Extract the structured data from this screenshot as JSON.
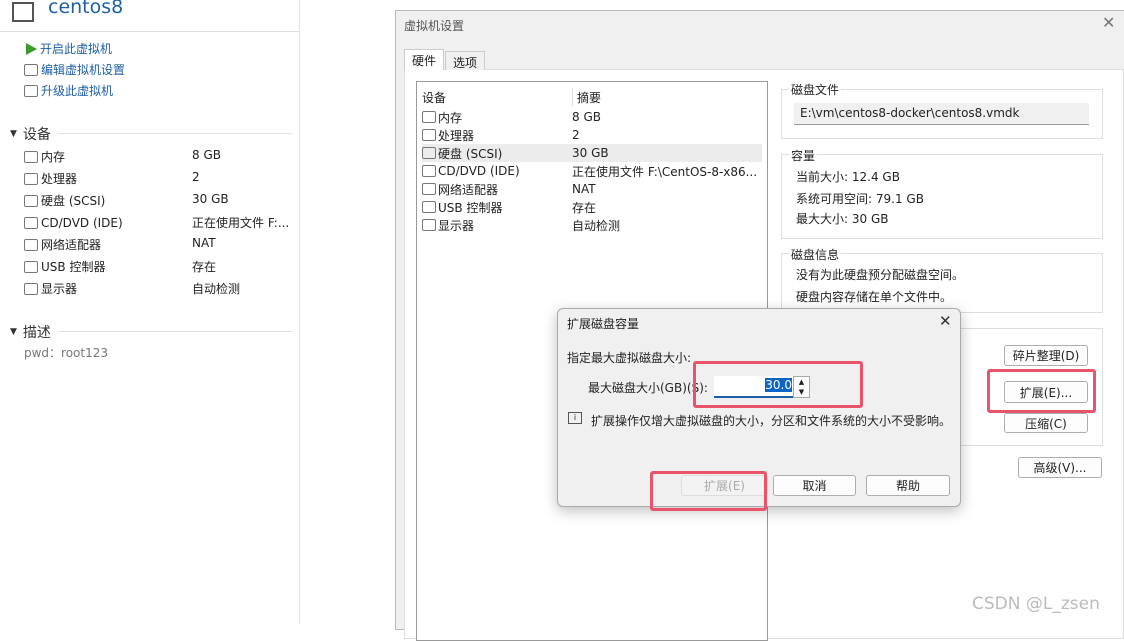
{
  "vm": {
    "title": "centos8",
    "actions": [
      "开启此虚拟机",
      "编辑虚拟机设置",
      "升级此虚拟机"
    ],
    "devices_header": "设备",
    "devices": [
      {
        "name": "内存",
        "value": "8 GB",
        "icon": "memory-icon"
      },
      {
        "name": "处理器",
        "value": "2",
        "icon": "cpu-icon"
      },
      {
        "name": "硬盘 (SCSI)",
        "value": "30 GB",
        "icon": "harddisk-icon"
      },
      {
        "name": "CD/DVD (IDE)",
        "value": "正在使用文件 F:...",
        "icon": "cdrom-icon"
      },
      {
        "name": "网络适配器",
        "value": "NAT",
        "icon": "network-icon"
      },
      {
        "name": "USB 控制器",
        "value": "存在",
        "icon": "usb-icon"
      },
      {
        "name": "显示器",
        "value": "自动检测",
        "icon": "display-icon"
      }
    ],
    "desc_header": "描述",
    "desc": "pwd：root123"
  },
  "settings": {
    "title": "虚拟机设置",
    "tabs": [
      "硬件",
      "选项"
    ],
    "columns": [
      "设备",
      "摘要"
    ],
    "devices": [
      {
        "name": "内存",
        "value": "8 GB"
      },
      {
        "name": "处理器",
        "value": "2"
      },
      {
        "name": "硬盘 (SCSI)",
        "value": "30 GB",
        "selected": true
      },
      {
        "name": "CD/DVD (IDE)",
        "value": "正在使用文件 F:\\CentOS-8-x86..."
      },
      {
        "name": "网络适配器",
        "value": "NAT"
      },
      {
        "name": "USB 控制器",
        "value": "存在"
      },
      {
        "name": "显示器",
        "value": "自动检测"
      }
    ],
    "disk_file_label": "磁盘文件",
    "disk_file": "E:\\vm\\centos8-docker\\centos8.vmdk",
    "capacity_label": "容量",
    "current_size": "当前大小: 12.4 GB",
    "free_space": "系统可用空间: 79.1 GB",
    "max_size": "最大大小: 30 GB",
    "disk_info_label": "磁盘信息",
    "info1": "没有为此硬盘预分配磁盘空间。",
    "info2": "硬盘内容存储在单个文件中。",
    "defrag": "碎片整理(D)",
    "expand": "扩展(E)...",
    "compact": "压缩(C)",
    "advanced": "高级(V)..."
  },
  "expand_dialog": {
    "title": "扩展磁盘容量",
    "prompt": "指定最大虚拟磁盘大小:",
    "field_label": "最大磁盘大小(GB)(S):",
    "value": "30.0",
    "note": "扩展操作仅增大虚拟磁盘的大小，分区和文件系统的大小不受影响。",
    "expand": "扩展(E)",
    "cancel": "取消",
    "help": "帮助"
  },
  "watermark": "CSDN @L_zsen",
  "colors": {
    "link": "#1c5fa8",
    "highlight": "#e9546b",
    "selection": "#0a64c8"
  }
}
